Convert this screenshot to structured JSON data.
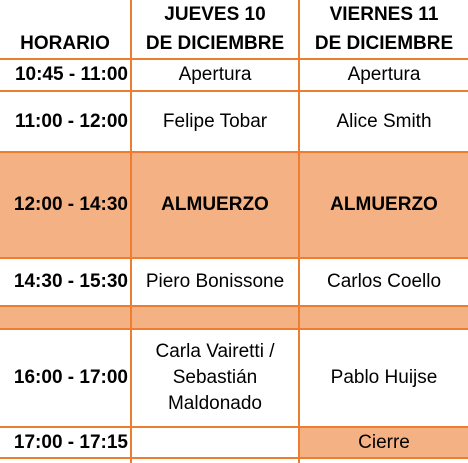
{
  "colors": {
    "accent": "#ed7d31",
    "highlight": "#f4b183"
  },
  "header": {
    "horario": "HORARIO",
    "jueves_line1": "JUEVES 10",
    "jueves_line2": "DE  DICIEMBRE",
    "viernes_line1": "VIERNES 11",
    "viernes_line2": "DE DICIEMBRE"
  },
  "rows": [
    {
      "time": "10:45 - 11:00",
      "jueves": "Apertura",
      "viernes": "Apertura"
    },
    {
      "time": "11:00 - 12:00",
      "jueves": "Felipe Tobar",
      "viernes": "Alice Smith"
    },
    {
      "time": "12:00 - 14:30",
      "jueves": "ALMUERZO",
      "viernes": "ALMUERZO"
    },
    {
      "time": "14:30 - 15:30",
      "jueves": "Piero Bonissone",
      "viernes": "Carlos Coello"
    },
    {
      "time": "",
      "jueves": "",
      "viernes": ""
    },
    {
      "time": "16:00 - 17:00",
      "jueves_lines": [
        "Carla Vairetti /",
        "Sebastián",
        "Maldonado"
      ],
      "viernes": "Pablo Huijse"
    },
    {
      "time": "17:00 - 17:15",
      "jueves": "",
      "viernes": "Cierre"
    }
  ]
}
